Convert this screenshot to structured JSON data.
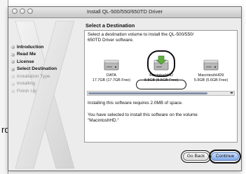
{
  "left_border": {
    "glyph": "rd"
  },
  "window": {
    "title": "Install QL-500/550/650TD Driver"
  },
  "sidebar": {
    "steps": [
      {
        "label": "Introduction",
        "state": "done"
      },
      {
        "label": "Read Me",
        "state": "done"
      },
      {
        "label": "License",
        "state": "done"
      },
      {
        "label": "Select Destination",
        "state": "current"
      },
      {
        "label": "Installation Type",
        "state": "pending"
      },
      {
        "label": "Installing",
        "state": "pending"
      },
      {
        "label": "Finish Up",
        "state": "pending"
      }
    ]
  },
  "panel": {
    "title": "Select a Destination",
    "intro_line1": "Select a destination volume to install the QL-500/550/",
    "intro_line2": "650TD Driver software.",
    "volumes": [
      {
        "name": "DATA",
        "size": "17.7GB (17.7GB Free)",
        "icon": "hard-drive-icon",
        "selected": false
      },
      {
        "name": "MacintoshHD",
        "size": "8.8GB (5.5GB Free)",
        "icon": "hard-drive-install-icon",
        "selected": true
      },
      {
        "name": "MacintoshHD9",
        "size": "5.9GB (5.6GB Free)",
        "icon": "hard-drive-icon",
        "selected": false
      }
    ],
    "requirement": "Installing this software requires 2.0MB of space.",
    "selection_note_line1": "You have selected to install this software on the volume",
    "selection_note_line2": "\"MacintoshHD.\""
  },
  "buttons": {
    "back": "Go Back",
    "continue": "Continue"
  },
  "colors": {
    "continue_button": "#7fa9e8",
    "window_bg": "#ececec",
    "scroll_thumb": "#6c7b98"
  }
}
